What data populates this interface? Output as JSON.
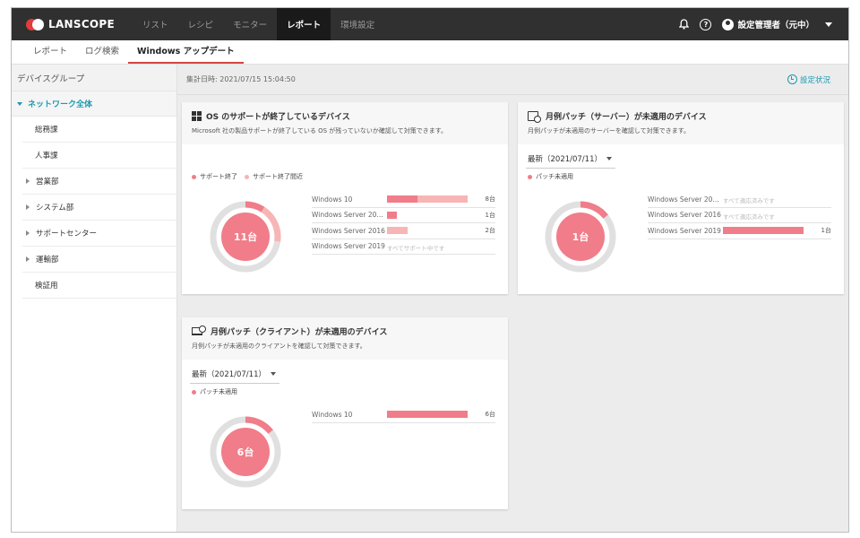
{
  "app": {
    "logo_text": "LANSCOPE",
    "nav": [
      {
        "label": "リスト",
        "active": false
      },
      {
        "label": "レシピ",
        "active": false
      },
      {
        "label": "モニター",
        "active": false
      },
      {
        "label": "レポート",
        "active": true
      },
      {
        "label": "環境設定",
        "active": false
      }
    ],
    "user_label": "設定管理者（元中）"
  },
  "subtabs": [
    {
      "label": "レポート",
      "active": false
    },
    {
      "label": "ログ検索",
      "active": false
    },
    {
      "label": "Windows アップデート",
      "active": true
    }
  ],
  "sidebar": {
    "header": "デバイスグループ",
    "root": "ネットワーク全体",
    "items": [
      {
        "label": "総務課",
        "has_children": false
      },
      {
        "label": "人事課",
        "has_children": false
      },
      {
        "label": "営業部",
        "has_children": true
      },
      {
        "label": "システム部",
        "has_children": true
      },
      {
        "label": "サポートセンター",
        "has_children": true
      },
      {
        "label": "運輸部",
        "has_children": true
      },
      {
        "label": "検証用",
        "has_children": false
      }
    ]
  },
  "main": {
    "timestamp": "集計日時: 2021/07/15 15:04:50",
    "settings_status": "設定状況"
  },
  "colors": {
    "accent": "#1a9bb0",
    "series_primary": "#f07d89",
    "series_light": "#f7b5b5",
    "donut_track": "#e0e0e0"
  },
  "cards": {
    "os_support": {
      "title": "OS のサポートが終了しているデバイス",
      "desc": "Microsoft 社の製品サポートが終了している OS が残っていないか確認して対策できます。",
      "legend": [
        "サポート終了",
        "サポート終了間近"
      ],
      "total_label": "11台",
      "chart_data": {
        "type": "bar",
        "categories": [
          "Windows 10",
          "Windows Server 2012...",
          "Windows Server 2016",
          "Windows Server 2019"
        ],
        "series": [
          {
            "name": "サポート終了",
            "values": [
              3,
              1,
              0,
              0
            ]
          },
          {
            "name": "サポート終了間近",
            "values": [
              5,
              0,
              2,
              0
            ]
          }
        ],
        "counts": [
          "8台",
          "1台",
          "2台",
          ""
        ],
        "notes": [
          "",
          "",
          "",
          "すべてサポート中です"
        ],
        "max": 8,
        "donut": {
          "ended": 1,
          "near": 2,
          "total": 11
        }
      }
    },
    "server_patch": {
      "title": "月例パッチ（サーバー）が未適用のデバイス",
      "desc": "月例パッチが未適用のサーバーを確認して対策できます。",
      "dropdown": "最新（2021/07/11）",
      "legend": [
        "パッチ未適用"
      ],
      "total_label": "1台",
      "chart_data": {
        "type": "bar",
        "categories": [
          "Windows Server 2012...",
          "Windows Server 2016",
          "Windows Server 2019"
        ],
        "values": [
          0,
          0,
          1
        ],
        "counts": [
          "",
          "",
          "1台"
        ],
        "notes": [
          "すべて適応済みです",
          "すべて適応済みです",
          ""
        ],
        "max": 1,
        "donut": {
          "unapplied": 1,
          "total": 7
        }
      }
    },
    "client_patch": {
      "title": "月例パッチ（クライアント）が未適用のデバイス",
      "desc": "月例パッチが未適用のクライアントを確認して対策できます。",
      "dropdown": "最新（2021/07/11）",
      "legend": [
        "パッチ未適用"
      ],
      "total_label": "6台",
      "chart_data": {
        "type": "bar",
        "categories": [
          "Windows 10"
        ],
        "values": [
          6
        ],
        "counts": [
          "6台"
        ],
        "notes": [
          ""
        ],
        "max": 6,
        "donut": {
          "unapplied": 1,
          "total": 7
        }
      }
    }
  }
}
